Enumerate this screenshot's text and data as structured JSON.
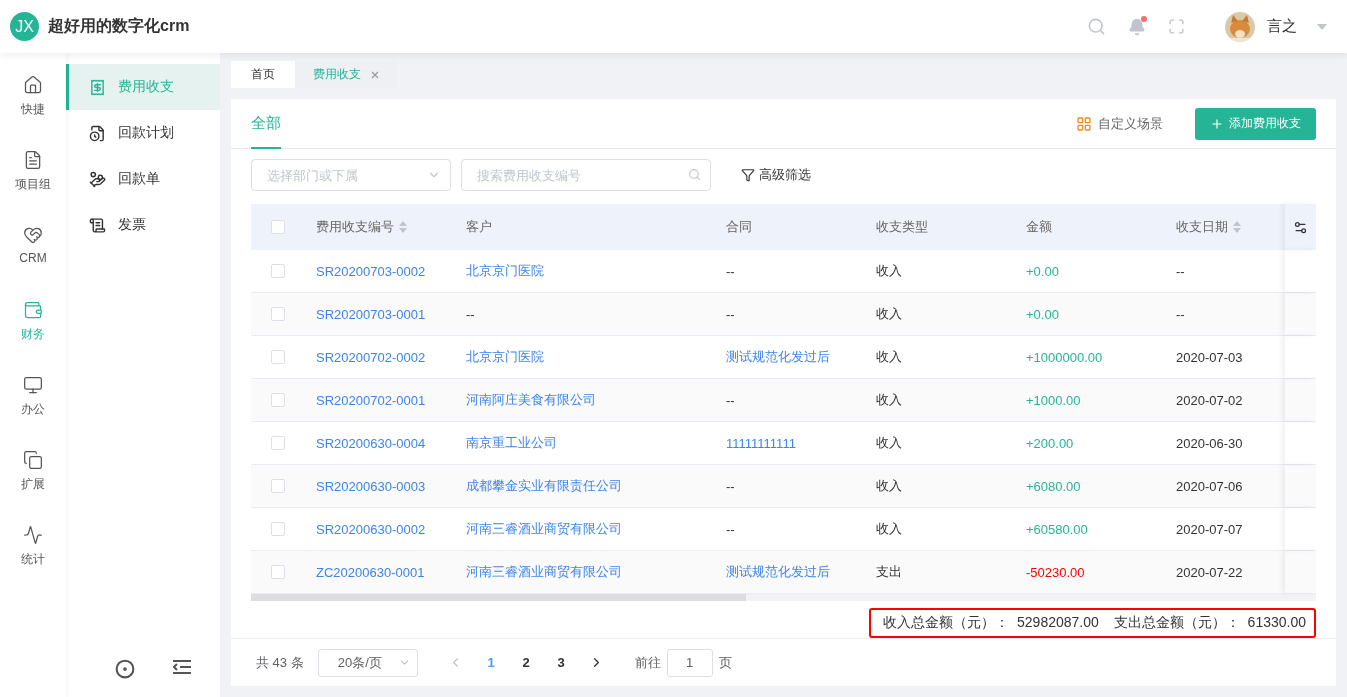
{
  "header": {
    "logo": "JX",
    "title": "超好用的数字化crm",
    "notification_dot": true,
    "user": "言之"
  },
  "rail": [
    {
      "label": "快捷",
      "selected": false
    },
    {
      "label": "项目组",
      "selected": false
    },
    {
      "label": "CRM",
      "selected": false
    },
    {
      "label": "财务",
      "selected": true
    },
    {
      "label": "办公",
      "selected": false
    },
    {
      "label": "扩展",
      "selected": false
    },
    {
      "label": "统计",
      "selected": false
    }
  ],
  "submenu": [
    {
      "label": "费用收支",
      "selected": true
    },
    {
      "label": "回款计划",
      "selected": false
    },
    {
      "label": "回款单",
      "selected": false
    },
    {
      "label": "发票",
      "selected": false
    }
  ],
  "page_tabs": [
    {
      "label": "首页",
      "selected": false,
      "closable": false
    },
    {
      "label": "费用收支",
      "selected": true,
      "closable": true
    }
  ],
  "card": {
    "tab": "全部",
    "custom_scene": "自定义场景",
    "add_button": "添加费用收支"
  },
  "filters": {
    "department": {
      "placeholder": "选择部门或下属"
    },
    "search": {
      "placeholder": "搜索费用收支编号"
    },
    "advanced": "高级筛选"
  },
  "table": {
    "all_checked": false,
    "columns": [
      {
        "label": "费用收支编号",
        "sortable": true
      },
      {
        "label": "客户",
        "sortable": false
      },
      {
        "label": "合同",
        "sortable": false
      },
      {
        "label": "收支类型",
        "sortable": false
      },
      {
        "label": "金额",
        "sortable": false
      },
      {
        "label": "收支日期",
        "sortable": true
      }
    ],
    "rows": [
      {
        "checked": false,
        "number": "SR20200703-0002",
        "customer": "北京京门医院",
        "customer_link": true,
        "contract": "--",
        "contract_link": false,
        "type": "收入",
        "kind": "income",
        "amount": "+0.00",
        "date": "--"
      },
      {
        "checked": false,
        "number": "SR20200703-0001",
        "customer": "--",
        "customer_link": false,
        "contract": "--",
        "contract_link": false,
        "type": "收入",
        "kind": "income",
        "amount": "+0.00",
        "date": "--"
      },
      {
        "checked": false,
        "number": "SR20200702-0002",
        "customer": "北京京门医院",
        "customer_link": true,
        "contract": "测试规范化发过后",
        "contract_link": true,
        "type": "收入",
        "kind": "income",
        "amount": "+1000000.00",
        "date": "2020-07-03"
      },
      {
        "checked": false,
        "number": "SR20200702-0001",
        "customer": "河南阿庄美食有限公司",
        "customer_link": true,
        "contract": "--",
        "contract_link": false,
        "type": "收入",
        "kind": "income",
        "amount": "+1000.00",
        "date": "2020-07-02"
      },
      {
        "checked": false,
        "number": "SR20200630-0004",
        "customer": "南京重工业公司",
        "customer_link": true,
        "contract": "11111111111",
        "contract_link": true,
        "type": "收入",
        "kind": "income",
        "amount": "+200.00",
        "date": "2020-06-30"
      },
      {
        "checked": false,
        "number": "SR20200630-0003",
        "customer": "成都攀金实业有限责任公司",
        "customer_link": true,
        "contract": "--",
        "contract_link": false,
        "type": "收入",
        "kind": "income",
        "amount": "+6080.00",
        "date": "2020-07-06"
      },
      {
        "checked": false,
        "number": "SR20200630-0002",
        "customer": "河南三睿酒业商贸有限公司",
        "customer_link": true,
        "contract": "--",
        "contract_link": false,
        "type": "收入",
        "kind": "income",
        "amount": "+60580.00",
        "date": "2020-07-07"
      },
      {
        "checked": false,
        "number": "ZC20200630-0001",
        "customer": "河南三睿酒业商贸有限公司",
        "customer_link": true,
        "contract": "测试规范化发过后",
        "contract_link": true,
        "type": "支出",
        "kind": "expense",
        "amount": "-50230.00",
        "date": "2020-07-22"
      }
    ]
  },
  "summary": [
    {
      "label": "收入总金额（元）：",
      "value": "52982087.00"
    },
    {
      "label": "支出总金额（元）：",
      "value": "61330.00"
    }
  ],
  "pagination": {
    "total": "共 43 条",
    "page_size": "20条/页",
    "pages": [
      {
        "label": "1",
        "selected": true
      },
      {
        "label": "2",
        "selected": false
      },
      {
        "label": "3",
        "selected": false
      }
    ],
    "goto": "前往",
    "goto_value": "1",
    "page_unit": "页"
  }
}
